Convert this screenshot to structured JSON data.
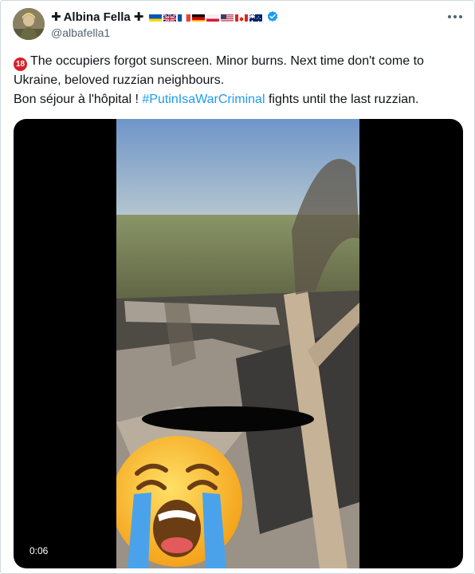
{
  "tweet": {
    "author": {
      "display_name": "Albina Fella",
      "cross_prefix": "✚",
      "cross_suffix": "✚",
      "handle": "@albafella1",
      "verified": true,
      "flags": [
        "ukraine-flag",
        "uk-flag",
        "france-flag",
        "germany-flag",
        "poland-flag",
        "usa-flag",
        "canada-flag",
        "australia-flag"
      ]
    },
    "more_icon": "more-horizontal-icon",
    "age_badge": "18",
    "text_line1": "The occupiers forgot sunscreen. Minor burns.  Next time don't come to Ukraine, beloved ruzzian neighbours.",
    "text_line2_prefix": "Bon séjour à l'hôpital ! ",
    "hashtag": "#PutinIsaWarCriminal",
    "text_line2_suffix": " fights until the last  ruzzian.",
    "media": {
      "duration": "0:06",
      "overlay_emoji": "loudly-crying-face-emoji"
    }
  },
  "colors": {
    "text": "#0f1419",
    "secondary_text": "#536471",
    "link": "#1d9bf0",
    "verified_badge": "#1d9bf0",
    "media_background": "#000000"
  }
}
